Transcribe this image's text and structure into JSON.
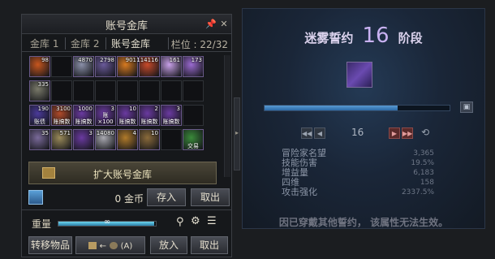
{
  "window": {
    "title": "账号金库"
  },
  "tabs": [
    {
      "label": "金库 1"
    },
    {
      "label": "金库 2"
    },
    {
      "label": "账号金库"
    }
  ],
  "slots": {
    "label": "栏位 : 22/32"
  },
  "items": [
    {
      "count": "98",
      "color": "#c7561e"
    },
    {
      "count": "4870",
      "color": "#8a8fa8"
    },
    {
      "count": "2798",
      "color": "#6a5a9a"
    },
    {
      "count": "901",
      "color": "#d77a20"
    },
    {
      "count": "114116",
      "color": "#c84a2a"
    },
    {
      "count": "161",
      "color": "#c8a0e8"
    },
    {
      "count": "173",
      "color": "#9a6ad0"
    },
    {
      "count": "335",
      "color": "#7a7a6a"
    },
    {
      "count": "190",
      "color": "#4a3a9a",
      "caption": "账债"
    },
    {
      "count": "3100",
      "color": "#b04a2a",
      "caption": "账搞数"
    },
    {
      "count": "1000",
      "color": "#6a3aa0",
      "caption": "账搞数"
    },
    {
      "count": "3",
      "color": "#6a3aa0",
      "caption": "账×100"
    },
    {
      "count": "10",
      "color": "#6a3aa0",
      "caption": "账搞数"
    },
    {
      "count": "2",
      "color": "#6a3aa0",
      "caption": "账搞数"
    },
    {
      "count": "3",
      "color": "#6a3aa0",
      "caption": "账搞数"
    },
    {
      "count": "35",
      "color": "#7a6a9a"
    },
    {
      "count": "571",
      "color": "#9a8a5a"
    },
    {
      "count": "3",
      "color": "#6a3aa0"
    },
    {
      "count": "14080",
      "color": "#a8a8b0"
    },
    {
      "count": "4",
      "color": "#b07a2a"
    },
    {
      "count": "10",
      "color": "#8a6a3a"
    },
    {
      "count": "",
      "color": "#3a8a3a",
      "caption": "交易"
    }
  ],
  "expand": {
    "label": "扩大账号金库"
  },
  "gold": {
    "amount": "0 金币",
    "deposit_label": "存入",
    "withdraw_label": "取出"
  },
  "weight": {
    "label": "重量",
    "value": "∞",
    "fill_fraction": 0.98
  },
  "bottom": {
    "transfer_label": "转移物品",
    "shortcut": "(A)",
    "put_label": "放入",
    "take_label": "取出"
  },
  "icons": [
    "close-icon",
    "pin-icon",
    "treasure-icon",
    "gold-icon",
    "search-icon",
    "gear-icon",
    "sort-icon",
    "chest-icon"
  ],
  "tooltip": {
    "title_prefix": "迷雾誓约",
    "stage": "16",
    "title_suffix": "阶段",
    "progress_fraction": 0.72,
    "level": "16",
    "stats": [
      {
        "label": "冒险家名望",
        "value": "3,365"
      },
      {
        "label": "技能伤害",
        "value": "19.5%"
      },
      {
        "label": "增益量",
        "value": "6,183"
      },
      {
        "label": "四维",
        "value": "158"
      },
      {
        "label": "攻击强化",
        "value": "2337.5%"
      }
    ],
    "warning": "因已穿戴其他誓约， 该属性无法生效。"
  }
}
